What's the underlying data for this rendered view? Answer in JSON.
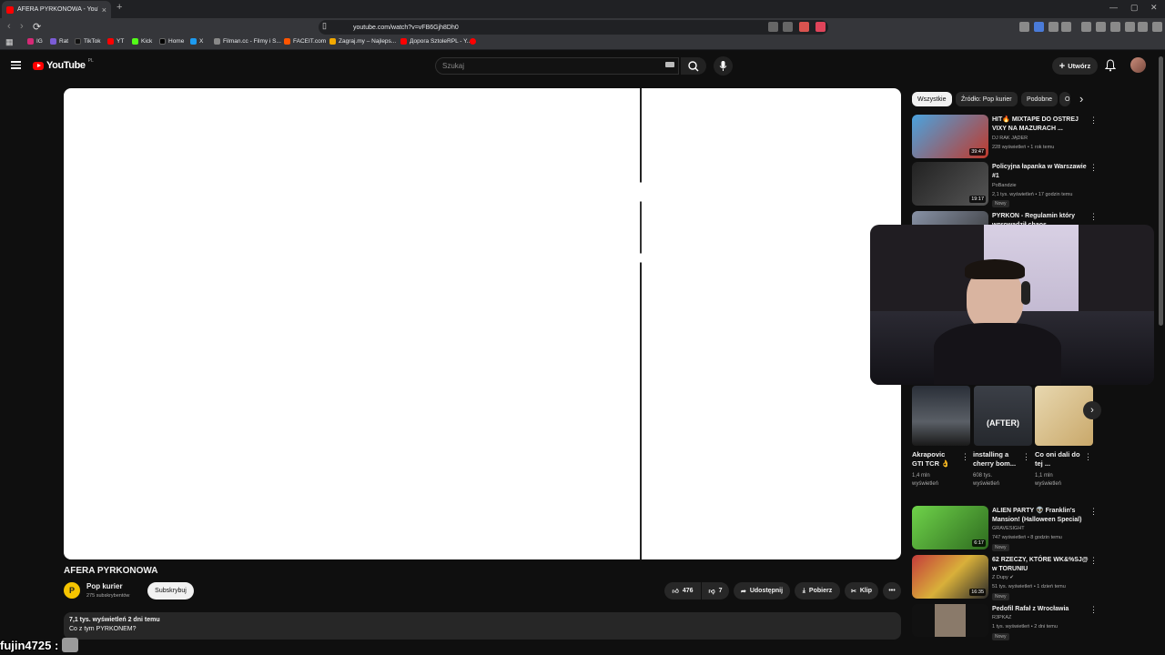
{
  "browser": {
    "tab_title": "AFERA PYRKONOWA - YouTube",
    "tab_close": "×",
    "new_tab": "+",
    "url": "youtube.com/watch?v=vFB6Gjh8Dh0",
    "window_controls": [
      "—",
      "▢",
      "✕"
    ],
    "bookmarks": [
      {
        "label": "IG",
        "color": "#d62976"
      },
      {
        "label": "Rat",
        "color": "#7b5cd6"
      },
      {
        "label": "TikTok",
        "color": "#111111"
      },
      {
        "label": "YT",
        "color": "#ff0000"
      },
      {
        "label": "Kick",
        "color": "#53fc18"
      },
      {
        "label": "Home",
        "color": "#000000"
      },
      {
        "label": "X",
        "color": "#1d9bf0"
      },
      {
        "label": "Filman.cc - Filmy i S...",
        "color": "#888888"
      },
      {
        "label": "FACEIT.com",
        "color": "#ff5500"
      },
      {
        "label": "Zagraj.my – Najleps...",
        "color": "#f2a900"
      },
      {
        "label": "Дорога SztoleRPL - Y...",
        "color": "#ff0000"
      },
      {
        "label": "",
        "color": "#ff0000"
      }
    ]
  },
  "yt_header": {
    "logo_text": "YouTube",
    "country": "PL",
    "search_placeholder": "Szukaj",
    "create_label": "Utwórz"
  },
  "video": {
    "title": "AFERA PYRKONOWA",
    "channel_initial": "P",
    "channel_name": "Pop kurier",
    "subscribers": "275 subskrybentów",
    "subscribe_label": "Subskrybuj",
    "likes": "476",
    "dislikes": "7",
    "share_label": "Udostępnij",
    "download_label": "Pobierz",
    "clip_label": "Klip",
    "more_label": "•••",
    "views_date": "7,1 tys. wyświetleń  2 dni temu",
    "description": "Co z tym PYRKONEM?"
  },
  "sidebar": {
    "chips": [
      "Wszystkie",
      "Źródło: Pop kurier",
      "Podobne",
      "O"
    ],
    "chip_next": "›",
    "recommendations": [
      {
        "title": "HIT🔥 MIXTAPE DO OSTREJ VIXY NA MAZURACH ...",
        "channel": "DJ RAK JĄDER",
        "meta": "228 wyświetleń • 1 rok temu",
        "badge": "",
        "duration": "39:47",
        "thumb": "#3a7fbf"
      },
      {
        "title": "Policyjna łapanka w Warszawie #1",
        "channel": "PoBandzie",
        "meta": "2,1 tys. wyświetleń • 17 godzin temu",
        "badge": "Nowy",
        "duration": "19:17",
        "thumb": "#3b3b3b"
      },
      {
        "title": "PYRKON - Regulamin który wprowadził chaos",
        "channel": "",
        "meta": "",
        "badge": "",
        "duration": "",
        "thumb": "#555a66"
      }
    ],
    "shorts": [
      {
        "title": "Akrapovic GTI TCR 👌",
        "views": "1,4 mln wyświetleń",
        "thumb": "#2a2f38"
      },
      {
        "title": "installing a cherry bom...",
        "views": "608 tys. wyświetleń",
        "thumb": "#3b3f47",
        "overlay": "(AFTER)"
      },
      {
        "title": "Co oni dali do tej ...",
        "views": "1,1 mln wyświetleń",
        "thumb": "#d7c7a0"
      }
    ],
    "shorts_next": "›",
    "recommendations2": [
      {
        "title": "ALIEN PARTY 👽 Franklin's Mansion! (Halloween Special)",
        "channel": "GRAVESIGHT",
        "meta": "747 wyświetleń • 8 godzin temu",
        "badge": "Nowy",
        "duration": "6:17",
        "thumb": "#4c9a3a"
      },
      {
        "title": "62 RZECZY, KTÓRE WK&%SJ@ w TORUNIU",
        "channel": "Z Dupy ✔",
        "meta": "51 tys. wyświetleń • 1 dzień temu",
        "badge": "Nowy",
        "duration": "16:35",
        "thumb": "#b08a2a"
      },
      {
        "title": "Pedofil Rafał z Wrocławia",
        "channel": "R3PKAZ",
        "meta": "1 tys. wyświetleń • 2 dni temu",
        "badge": "Nowy",
        "duration": "",
        "thumb": "#6a6a6a"
      }
    ]
  },
  "stream_overlay": {
    "username": "fujin4725 :"
  }
}
